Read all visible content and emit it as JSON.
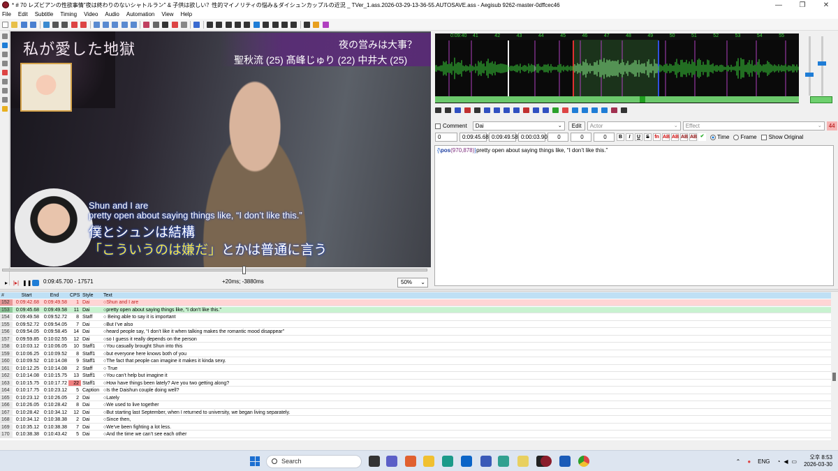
{
  "window": {
    "title": "* # 70 レズビアンの性欲事情\"夜は終わりのないシャトルラン\" & 子供は欲しい？性的マイノリティの悩み＆ダイシュンカップルの近況 _ TVer_1.ass.2026-03-29-13-36-55.AUTOSAVE.ass - Aegisub 9262-master-0dffcec46",
    "minimize": "—",
    "maximize": "❐",
    "close": "✕"
  },
  "menu": [
    "File",
    "Edit",
    "Subtitle",
    "Timing",
    "Video",
    "Audio",
    "Automation",
    "View",
    "Help"
  ],
  "video": {
    "corner_title": "私が愛した地獄",
    "top_right_question": "夜の営みは大事？",
    "cast_names": "聖秋流 (25) 髙峰じゅり (22) 中井大 (25)",
    "sub_en_line1": "Shun and I are",
    "sub_en_line2": "pretty open about saying things like, “I don’t like this.”",
    "sub_jp_line1": "僕とシュンは結構",
    "sub_jp_line2_hl": "「こういうのは嫌だ」",
    "sub_jp_line2_rest": "とかは普通に言う",
    "seek_fraction": 0.567,
    "time": "0:09:45.700 - 17571",
    "offset": "+20ms; -3880ms",
    "zoom": "50%"
  },
  "audio": {
    "ruler": [
      "0:09:40",
      "41",
      "42",
      "43",
      "44",
      "45",
      "46",
      "47",
      "48",
      "49",
      "50",
      "51",
      "52",
      "53",
      "54",
      "55"
    ]
  },
  "edit": {
    "comment_label": "Comment",
    "style": "Dai",
    "edit_button": "Edit",
    "actor_placeholder": "Actor",
    "effect_placeholder": "Effect",
    "char_count": "44",
    "layer": "0",
    "start": "0:09:45.68",
    "end": "0:09:49.58",
    "duration": "0:00:03.90",
    "margin_l": "0",
    "margin_r": "0",
    "margin_v": "0",
    "fmt_b": "B",
    "fmt_i": "I",
    "fmt_u": "U",
    "fmt_s": "S",
    "fmt_fn": "fn",
    "fmt_ab1": "AB",
    "fmt_ab2": "AB",
    "fmt_ab3": "AB",
    "fmt_ab4": "AB",
    "time_radio": "Time",
    "frame_radio": "Frame",
    "show_original": "Show Original",
    "text_brace_open": "{\\",
    "text_tag": "pos",
    "text_args": "(970,878)",
    "text_brace_close": "}",
    "text_body": "pretty open about saying things like, “I don’t like this.”"
  },
  "grid": {
    "headers": {
      "num": "#",
      "start": "Start",
      "end": "End",
      "cps": "CPS",
      "style": "Style",
      "text": "Text"
    },
    "rows": [
      {
        "num": "152",
        "start": "0:09:42.68",
        "end": "0:09:49.58",
        "cps": "1",
        "style": "Dai",
        "text": "○Shun and I are"
      },
      {
        "num": "153",
        "start": "0:09:45.68",
        "end": "0:09:49.58",
        "cps": "11",
        "style": "Dai",
        "text": "○pretty open about saying things like, “I don’t like this.”"
      },
      {
        "num": "154",
        "start": "0:09:49.58",
        "end": "0:09:52.72",
        "cps": "8",
        "style": "Staff",
        "text": "○ Being able to say it is important"
      },
      {
        "num": "155",
        "start": "0:09:52.72",
        "end": "0:09:54.05",
        "cps": "7",
        "style": "Dai",
        "text": "○But I’ve also"
      },
      {
        "num": "156",
        "start": "0:09:54.05",
        "end": "0:09:58.45",
        "cps": "14",
        "style": "Dai",
        "text": "○heard people say, “I don’t like it when talking makes the romantic mood disappear”"
      },
      {
        "num": "157",
        "start": "0:09:59.85",
        "end": "0:10:02.55",
        "cps": "12",
        "style": "Dai",
        "text": "○so I guess it really depends on the person"
      },
      {
        "num": "158",
        "start": "0:10:03.12",
        "end": "0:10:06.05",
        "cps": "10",
        "style": "Staff1",
        "text": "○You casually brought Shun into this"
      },
      {
        "num": "159",
        "start": "0:10:06.25",
        "end": "0:10:09.52",
        "cps": "8",
        "style": "Staff1",
        "text": "○but everyone here knows both of you"
      },
      {
        "num": "160",
        "start": "0:10:09.52",
        "end": "0:10:14.08",
        "cps": "9",
        "style": "Staff1",
        "text": "○The fact that people can imagine it makes it kinda sexy."
      },
      {
        "num": "161",
        "start": "0:10:12.25",
        "end": "0:10:14.08",
        "cps": "2",
        "style": "Staff",
        "text": "○ True"
      },
      {
        "num": "162",
        "start": "0:10:14.08",
        "end": "0:10:15.75",
        "cps": "13",
        "style": "Staff1",
        "text": "○You can’t help but imagine it"
      },
      {
        "num": "163",
        "start": "0:10:15.75",
        "end": "0:10:17.72",
        "cps": "22",
        "style": "Staff1",
        "text": "○How have things been lately? Are you two getting along?"
      },
      {
        "num": "164",
        "start": "0:10:17.75",
        "end": "0:10:23.12",
        "cps": "5",
        "style": "Caption",
        "text": "○Is the Daishun couple doing well?"
      },
      {
        "num": "165",
        "start": "0:10:23.12",
        "end": "0:10:26.05",
        "cps": "2",
        "style": "Dai",
        "text": "○Lately"
      },
      {
        "num": "166",
        "start": "0:10:26.05",
        "end": "0:10:28.42",
        "cps": "8",
        "style": "Dai",
        "text": "○We used to live together"
      },
      {
        "num": "167",
        "start": "0:10:28.42",
        "end": "0:10:34.12",
        "cps": "12",
        "style": "Dai",
        "text": "○But starting last September, when I returned to university, we began living separately."
      },
      {
        "num": "168",
        "start": "0:10:34.12",
        "end": "0:10:38.38",
        "cps": "2",
        "style": "Dai",
        "text": "○Since then,"
      },
      {
        "num": "169",
        "start": "0:10:35.12",
        "end": "0:10:38.38",
        "cps": "7",
        "style": "Dai",
        "text": "○We’ve been fighting a lot less."
      },
      {
        "num": "170",
        "start": "0:10:38.38",
        "end": "0:10:43.42",
        "cps": "5",
        "style": "Dai",
        "text": "○And the time we can’t see each other"
      }
    ]
  },
  "taskbar": {
    "search_label": "Search",
    "lang": "ENG",
    "time": "오후 8:53",
    "date": "2026-03-30"
  }
}
